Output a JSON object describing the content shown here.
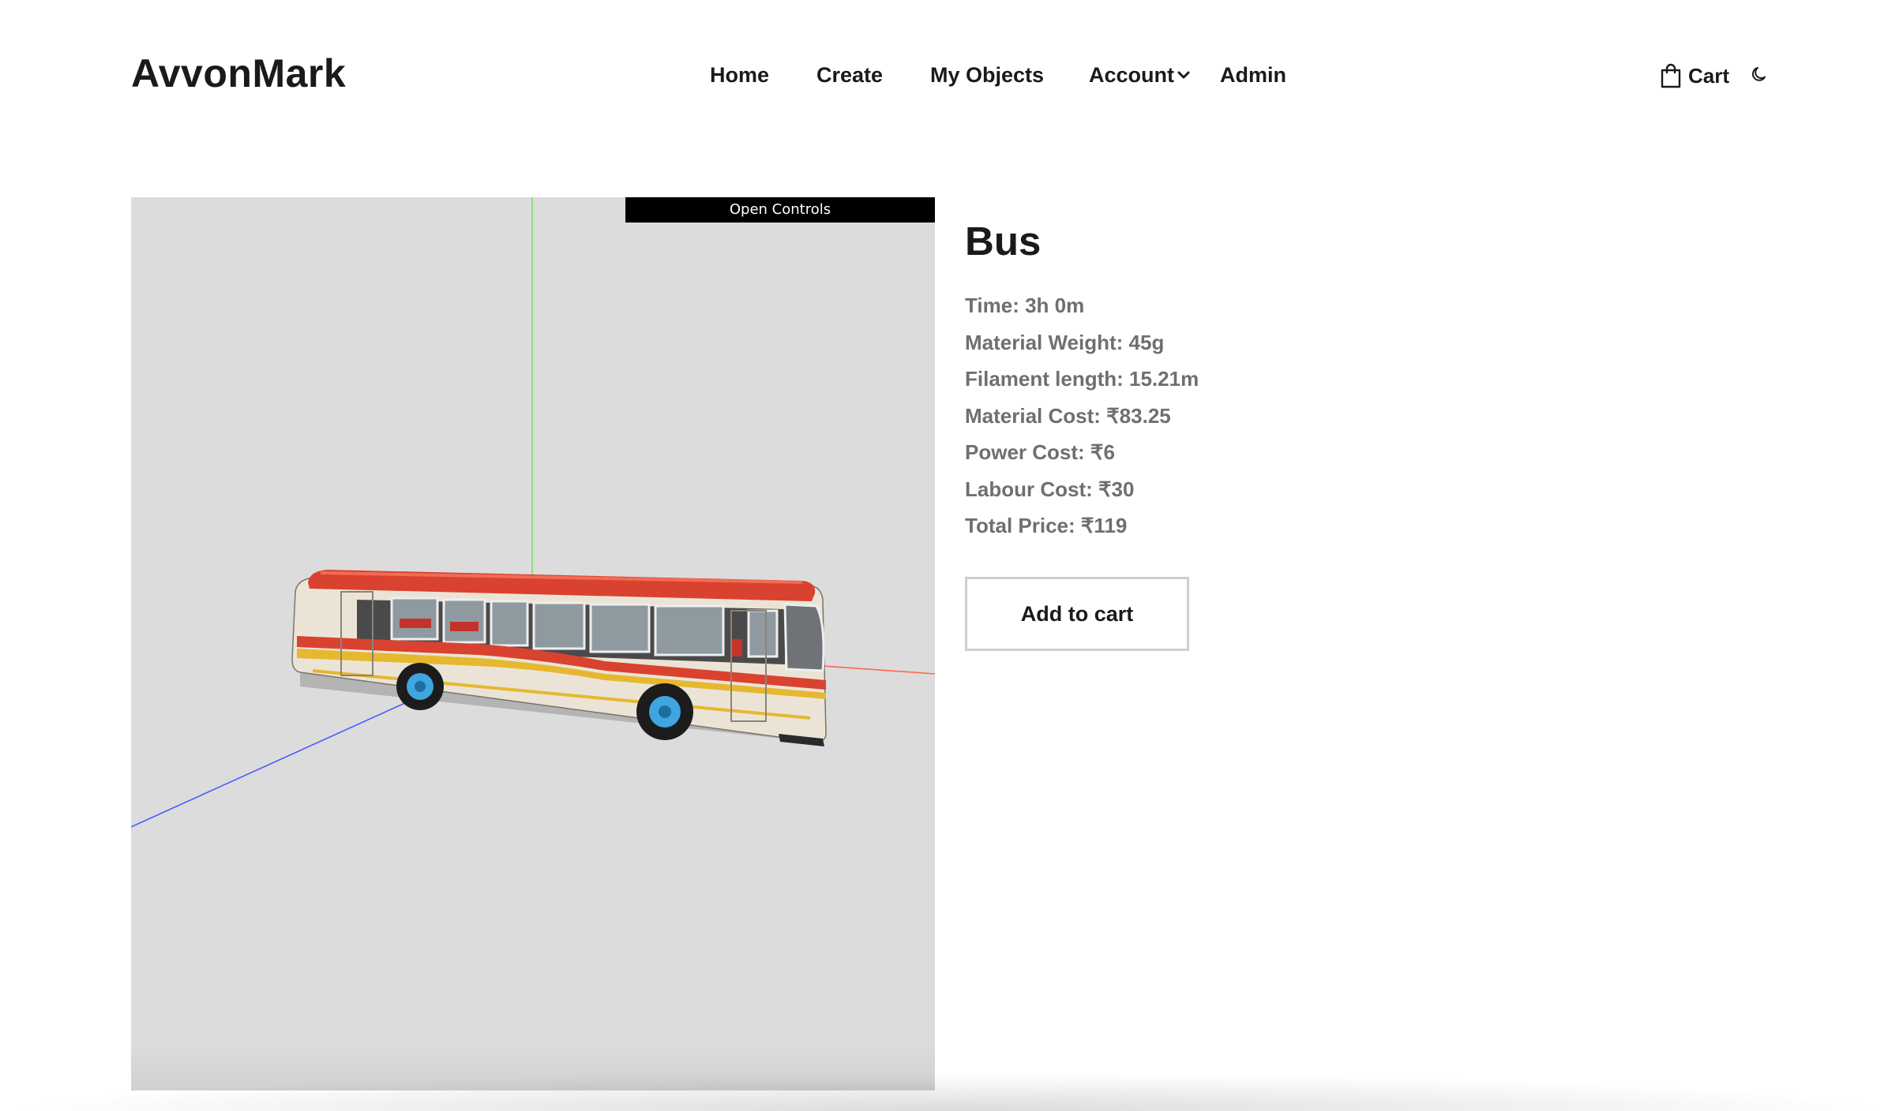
{
  "header": {
    "brand": "AvvonMark",
    "nav": {
      "home": "Home",
      "create": "Create",
      "my_objects": "My Objects",
      "account": "Account",
      "admin": "Admin"
    },
    "cart_label": "Cart",
    "icons": {
      "cart": "shopping-bag-icon",
      "account_dropdown": "chevron-down-icon",
      "theme": "moon-icon"
    }
  },
  "viewer": {
    "open_controls_label": "Open Controls",
    "background_color": "#dcdcdc",
    "axis_colors": {
      "x": "#ff6a4d",
      "y": "#7ddc6a",
      "z": "#4a5cff"
    }
  },
  "product": {
    "title": "Bus",
    "specs": {
      "time": "Time: 3h 0m",
      "material_weight": "Material Weight: 45g",
      "filament_length": "Filament length: 15.21m",
      "material_cost": "Material Cost: ₹83.25",
      "power_cost": "Power Cost: ₹6",
      "labour_cost": "Labour Cost: ₹30",
      "total_price": "Total Price: ₹119"
    },
    "add_to_cart_label": "Add to cart"
  }
}
